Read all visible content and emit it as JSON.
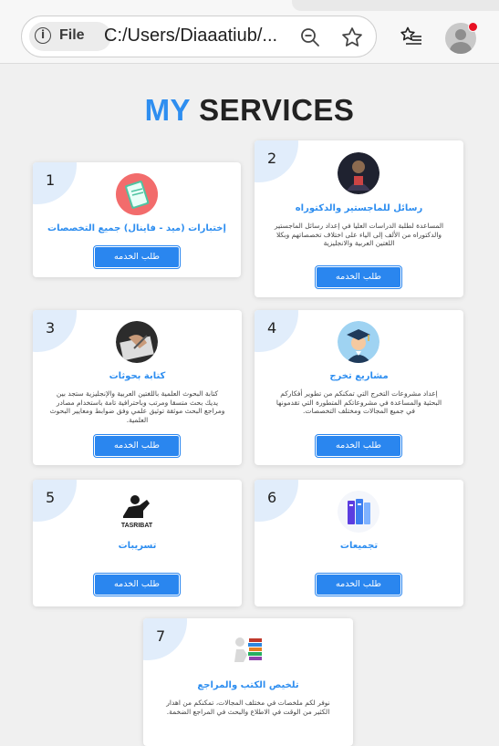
{
  "browser": {
    "site_info_label": "File",
    "url": "C:/Users/Diaaatiub/...",
    "zoom_icon": "zoom-out-icon",
    "star_icon": "star-icon",
    "favorites_icon": "favorites-icon",
    "profile_icon": "profile-avatar",
    "notification_color": "#e81123"
  },
  "page": {
    "title_accent": "MY",
    "title_rest": "SERVICES",
    "accent_color": "#2e8ef0"
  },
  "services": [
    {
      "number": "1",
      "title": "إختبارات (ميد - فاينال) جميع التخصصات",
      "description": "",
      "button": "طلب الخدمه",
      "icon": "exam-book-icon"
    },
    {
      "number": "2",
      "title": "رسائل للماجستير والدكتوراه",
      "description": "المساعدة لطلبة الدراسات العليا في إعداد رسائل الماجستير والدكتوراه من الألف إلى الياء على اختلاف تخصصاتهم وبكلا اللغتين العربية والانجليزية",
      "button": "طلب الخدمه",
      "icon": "thesis-icon"
    },
    {
      "number": "3",
      "title": "كتابة بحوثات",
      "description": "كتابة البحوث العلمية باللغتين العربية والإنجليزية ستجد بين يديك بحث متسقا ومرتب وباحترافية تامة باستخدام مصادر ومراجع البحث موثقة توثيق علمي وفق ضوابط ومعايير البحوث العلمية.",
      "button": "طلب الخدمه",
      "icon": "writing-icon"
    },
    {
      "number": "4",
      "title": "مشاريع تخرج",
      "description": "إعداد مشروعات التخرج التي تمكنكم من تطوير أفكاركم البحثية والمساعدة في مشروعاتكم المتطورة التي تقدمونها في جميع المجالات ومختلف التخصصات.",
      "button": "طلب الخدمه",
      "icon": "graduate-icon"
    },
    {
      "number": "5",
      "title": "تسريبات",
      "description": "",
      "button": "طلب الخدمه",
      "icon": "tasribat-logo-icon",
      "logo_text": "TASRIBAT"
    },
    {
      "number": "6",
      "title": "تجميعات",
      "description": "",
      "button": "طلب الخدمه",
      "icon": "books-stack-icon"
    },
    {
      "number": "7",
      "title": "تلخيص الكتب والمراجع",
      "description": "نوفر لكم ملخصات في مختلف المجالات، تمكنكم من اهدار الكثير من الوقت في الاطلاع والبحث في المراجع الضخمة.",
      "button": "",
      "icon": "reading-books-icon"
    }
  ]
}
